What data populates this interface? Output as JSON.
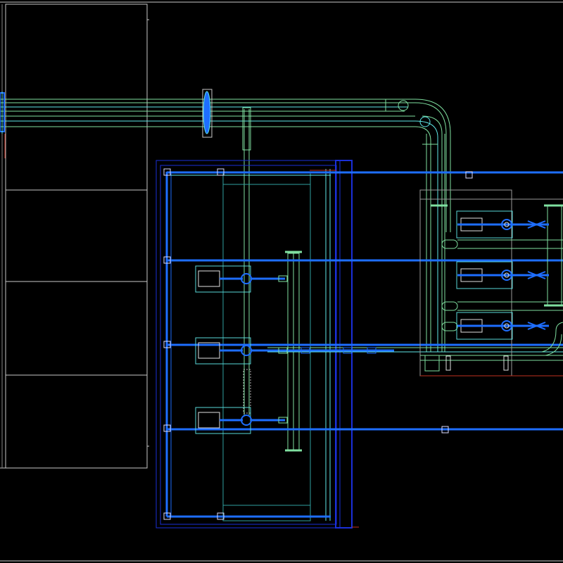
{
  "canvas": {
    "background": "#000000",
    "view": "CAD piping plan"
  },
  "colors": {
    "frame": "#c8c8c8",
    "pipe_green": "#7fe0a0",
    "pipe_cyan": "#5fe8e8",
    "main_blue": "#1e6eff",
    "dark_blue": "#1a2fd8",
    "accent_red": "#c03020",
    "pump_body": "#58d8d8",
    "fitting_white": "#e0e0e0"
  },
  "drawing": {
    "room_left": {
      "name": "equipment-room-outline"
    },
    "pump_room": {
      "name": "pump-room",
      "pump_count": 3
    },
    "right_skid": {
      "name": "right-pump-skid",
      "pump_count": 3
    },
    "main_headers": {
      "count": 4
    },
    "supply_bundle": {
      "line_count": 7
    }
  }
}
